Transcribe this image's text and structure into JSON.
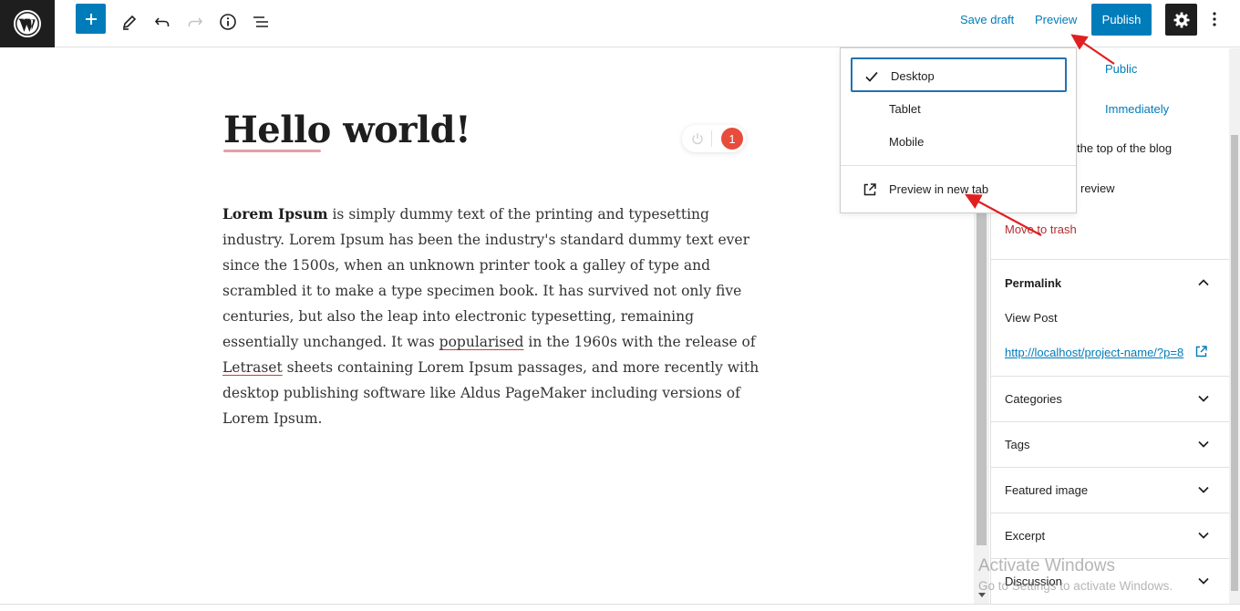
{
  "toolbar": {
    "save_draft": "Save draft",
    "preview": "Preview",
    "publish": "Publish"
  },
  "editor": {
    "title": "Hello world!",
    "grammar_count": "1",
    "body_bold": "Lorem Ipsum",
    "body_1": " is simply dummy text of the printing and typesetting industry. Lorem Ipsum has been the industry's standard dummy text ever since the 1500s, when an unknown printer took a galley of type and scrambled it to make a type specimen book. It has survived not only five centuries, but also the leap into electronic typesetting, remaining essentially unchanged. It was ",
    "body_word_1": "popularised",
    "body_2": " in the 1960s with the release of ",
    "body_word_2": "Letraset",
    "body_3": " sheets containing Lorem Ipsum passages, and more recently with desktop publishing software like Aldus PageMaker including versions of Lorem Ipsum."
  },
  "preview_menu": {
    "desktop": "Desktop",
    "tablet": "Tablet",
    "mobile": "Mobile",
    "new_tab": "Preview in new tab"
  },
  "sidebar": {
    "visibility_value": "Public",
    "publish_value": "Immediately",
    "stick_text": "the top of the blog",
    "pending_text": "review",
    "trash": "Move to trash",
    "permalink_title": "Permalink",
    "view_post_label": "View Post",
    "permalink_url": "http://localhost/project-name/?p=8",
    "categories": "Categories",
    "tags": "Tags",
    "featured_image": "Featured image",
    "excerpt": "Excerpt",
    "discussion": "Discussion"
  },
  "watermark": {
    "title": "Activate Windows",
    "subtitle": "Go to Settings to activate Windows."
  },
  "colors": {
    "accent": "#007cba",
    "wp_dark": "#1e1e1e",
    "annotation_arrow": "#e02020",
    "trash": "#b32d2e"
  },
  "icons": [
    "wordpress-logo-icon",
    "plus-icon",
    "pencil-icon",
    "undo-icon",
    "redo-icon",
    "info-icon",
    "list-view-icon",
    "gear-icon",
    "more-vertical-icon",
    "check-icon",
    "external-link-icon",
    "chevron-up-icon",
    "chevron-down-icon",
    "power-icon"
  ]
}
